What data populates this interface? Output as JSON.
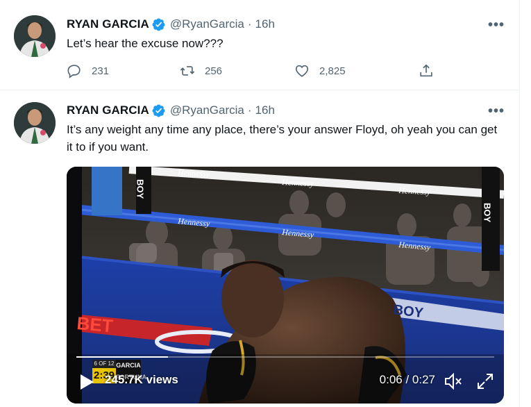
{
  "colors": {
    "text": "#0f1419",
    "secondary": "#536471",
    "verified": "#1d9bf0",
    "divider": "#eff3f4"
  },
  "tweets": [
    {
      "author": {
        "name": "RYAN GARCIA",
        "handle": "@RyanGarcia",
        "verified": true
      },
      "time": "16h",
      "text": "Let’s hear the excuse now???",
      "actions": {
        "replies": "231",
        "retweets": "256",
        "likes": "2,825"
      },
      "icons": [
        "reply-icon",
        "retweet-icon",
        "like-icon",
        "share-icon",
        "more-icon"
      ]
    },
    {
      "author": {
        "name": "RYAN GARCIA",
        "handle": "@RyanGarcia",
        "verified": true
      },
      "time": "16h",
      "text": "It’s any weight any time any place, there’s your answer Floyd, oh yeah you can get it to if you want.",
      "video": {
        "views": "245.7K views",
        "position": "0:06 / 0:27",
        "progress": 0.22,
        "scoreboard": {
          "round": "6 OF 12",
          "clock": "2:39",
          "fighter_top": "GARCIA",
          "fighter_bottom": "FORTUNA"
        },
        "ring_signage": [
          "Hennessy",
          "Hennessy",
          "Hennessy",
          "Hennessy",
          "Hennessy",
          "Hennessy"
        ],
        "mat_signage": [
          "BET",
          "BOY"
        ],
        "corner_pad_text": [
          "BOY",
          "BOY"
        ],
        "icons": [
          "play-icon",
          "mute-icon",
          "fullscreen-icon"
        ]
      }
    }
  ]
}
